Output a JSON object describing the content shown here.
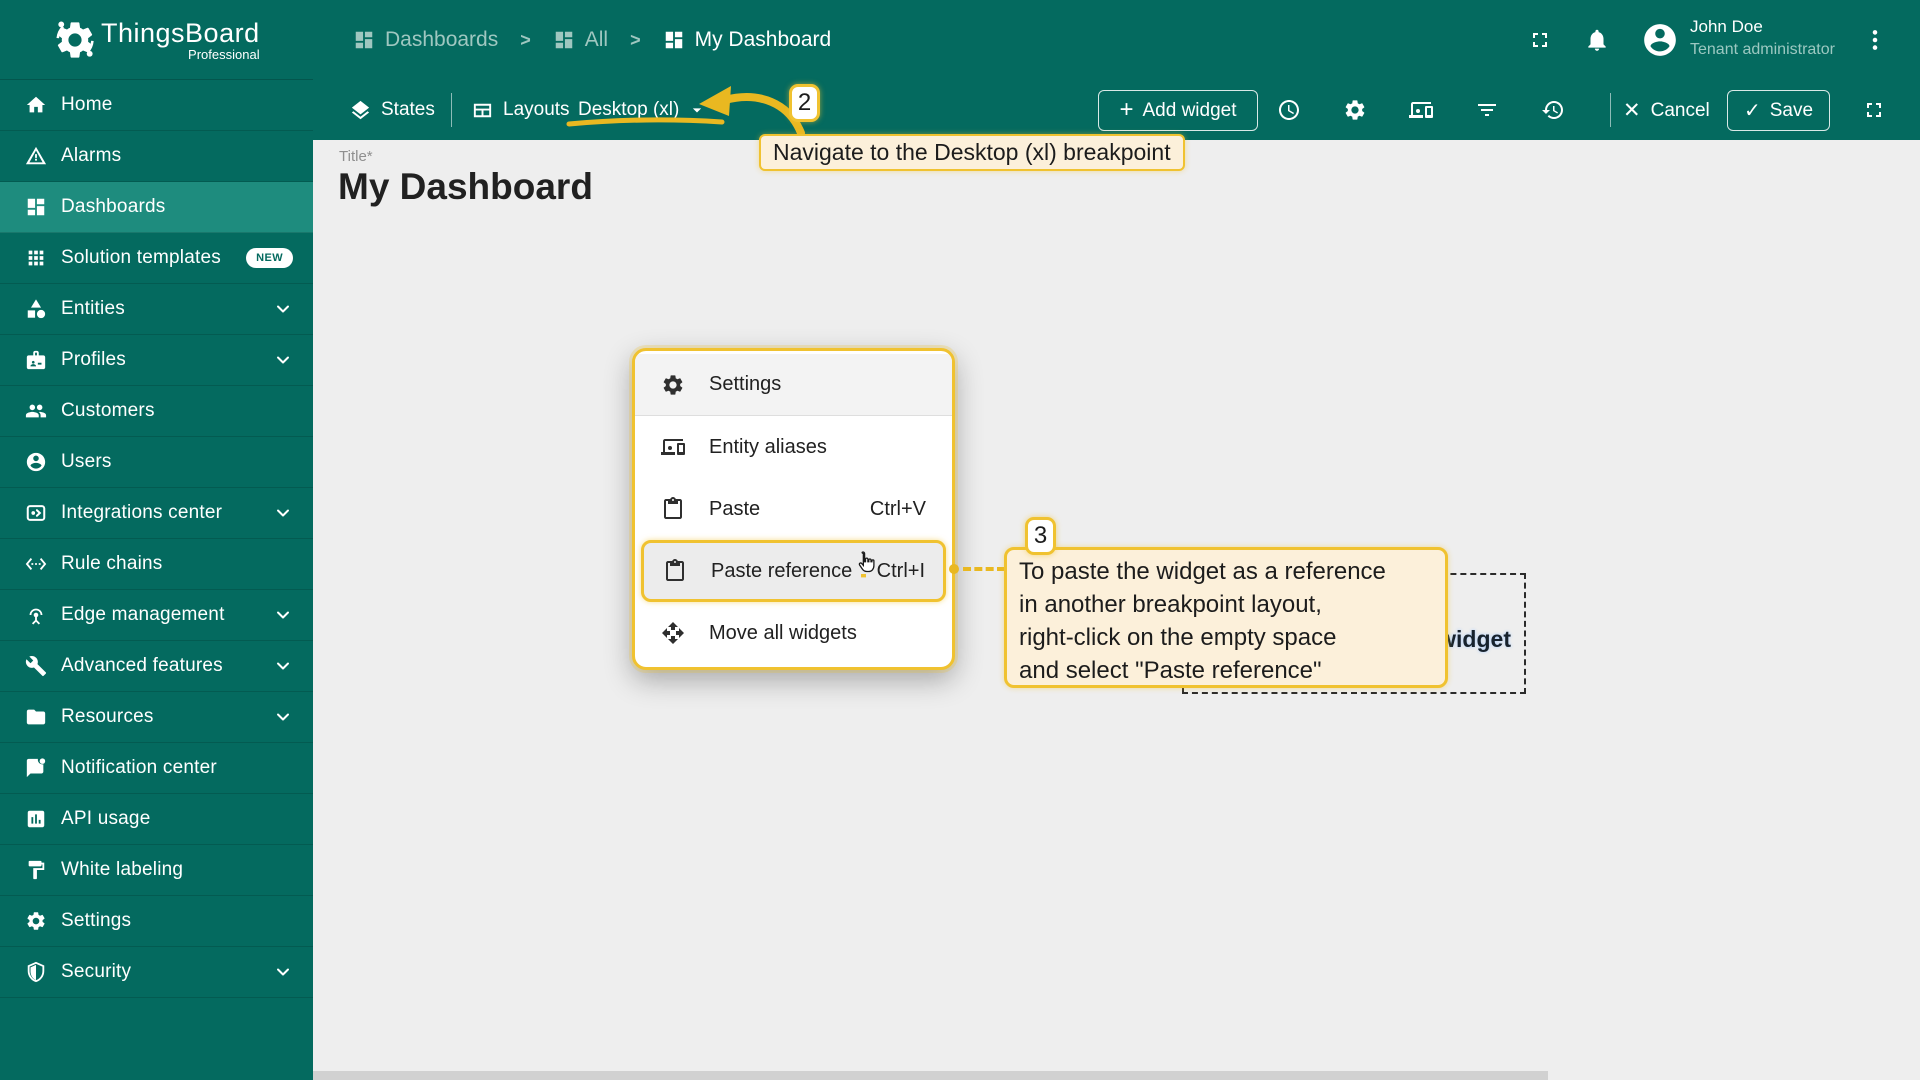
{
  "brand": {
    "name": "ThingsBoard",
    "edition": "Professional",
    "logo_icon": "thingsboard-gear-icon"
  },
  "breadcrumb": {
    "separator": ">",
    "items": [
      {
        "label": "Dashboards",
        "icon": "dashboard-icon",
        "current": false
      },
      {
        "label": "All",
        "icon": "dashboard-icon",
        "current": false
      },
      {
        "label": "My Dashboard",
        "icon": "dashboard-icon",
        "current": true
      }
    ]
  },
  "header": {
    "user": {
      "name": "John Doe",
      "role": "Tenant administrator"
    },
    "icons": [
      "fullscreen-icon",
      "notifications-bell-icon",
      "avatar",
      "kebab-menu-icon"
    ]
  },
  "sidebar": {
    "items": [
      {
        "label": "Home",
        "icon": "home-icon",
        "active": false,
        "chevron": false,
        "badge": ""
      },
      {
        "label": "Alarms",
        "icon": "alarms-warning-icon",
        "active": false,
        "chevron": false,
        "badge": ""
      },
      {
        "label": "Dashboards",
        "icon": "dashboard-icon",
        "active": true,
        "chevron": false,
        "badge": ""
      },
      {
        "label": "Solution templates",
        "icon": "apps-grid-icon",
        "active": false,
        "chevron": false,
        "badge": "NEW"
      },
      {
        "label": "Entities",
        "icon": "entities-shapes-icon",
        "active": false,
        "chevron": true,
        "badge": ""
      },
      {
        "label": "Profiles",
        "icon": "profiles-badge-icon",
        "active": false,
        "chevron": true,
        "badge": ""
      },
      {
        "label": "Customers",
        "icon": "customers-people-icon",
        "active": false,
        "chevron": false,
        "badge": ""
      },
      {
        "label": "Users",
        "icon": "user-circle-icon",
        "active": false,
        "chevron": false,
        "badge": ""
      },
      {
        "label": "Integrations center",
        "icon": "integrations-icon",
        "active": false,
        "chevron": true,
        "badge": ""
      },
      {
        "label": "Rule chains",
        "icon": "rule-chains-icon",
        "active": false,
        "chevron": false,
        "badge": ""
      },
      {
        "label": "Edge management",
        "icon": "edge-antenna-icon",
        "active": false,
        "chevron": true,
        "badge": ""
      },
      {
        "label": "Advanced features",
        "icon": "advanced-tools-icon",
        "active": false,
        "chevron": true,
        "badge": ""
      },
      {
        "label": "Resources",
        "icon": "folder-icon",
        "active": false,
        "chevron": true,
        "badge": ""
      },
      {
        "label": "Notification center",
        "icon": "notification-chat-icon",
        "active": false,
        "chevron": false,
        "badge": ""
      },
      {
        "label": "API usage",
        "icon": "api-chart-icon",
        "active": false,
        "chevron": false,
        "badge": ""
      },
      {
        "label": "White labeling",
        "icon": "paint-roller-icon",
        "active": false,
        "chevron": false,
        "badge": ""
      },
      {
        "label": "Settings",
        "icon": "gear-icon",
        "active": false,
        "chevron": false,
        "badge": ""
      },
      {
        "label": "Security",
        "icon": "security-shield-icon",
        "active": false,
        "chevron": true,
        "badge": ""
      }
    ]
  },
  "toolbar": {
    "states_label": "States",
    "layouts_label": "Layouts",
    "breakpoint_value": "Desktop (xl)",
    "add_widget_label": "Add widget",
    "cancel_label": "Cancel",
    "save_label": "Save",
    "icon_buttons": [
      "time-window-icon",
      "dashboard-settings-gear-icon",
      "entity-aliases-icon",
      "filters-icon",
      "version-history-icon"
    ],
    "fullscreen_icon": "fullscreen-icon"
  },
  "page": {
    "title_label": "Title*",
    "heading": "My Dashboard"
  },
  "context_menu": {
    "items": [
      {
        "label": "Settings",
        "icon": "gear-icon",
        "shortcut": "",
        "highlighted": false,
        "first": true
      },
      {
        "label": "Entity aliases",
        "icon": "entity-aliases-icon",
        "shortcut": "",
        "highlighted": false,
        "first": false
      },
      {
        "label": "Paste",
        "icon": "paste-clipboard-icon",
        "shortcut": "Ctrl+V",
        "highlighted": false,
        "first": false
      },
      {
        "label": "Paste reference",
        "icon": "paste-clipboard-icon",
        "shortcut": "Ctrl+I",
        "highlighted": true,
        "first": false
      },
      {
        "label": "Move all widgets",
        "icon": "move-widgets-icon",
        "shortcut": "",
        "highlighted": false,
        "first": false
      }
    ]
  },
  "tutorial": {
    "step2": {
      "number": "2",
      "text": "Navigate to the Desktop (xl) breakpoint"
    },
    "step3": {
      "number": "3",
      "lines": [
        "To paste the widget as a reference",
        "in another breakpoint layout,",
        "right-click on the empty space",
        "and select \"Paste reference\""
      ]
    },
    "widget_placeholder_label": "widget"
  },
  "colors": {
    "teal": "#046a5f",
    "teal_active": "#1e8c7e",
    "accent_yellow": "#f0c230",
    "callout_cream": "#fcf0da",
    "content_bg": "#eeeeee"
  }
}
